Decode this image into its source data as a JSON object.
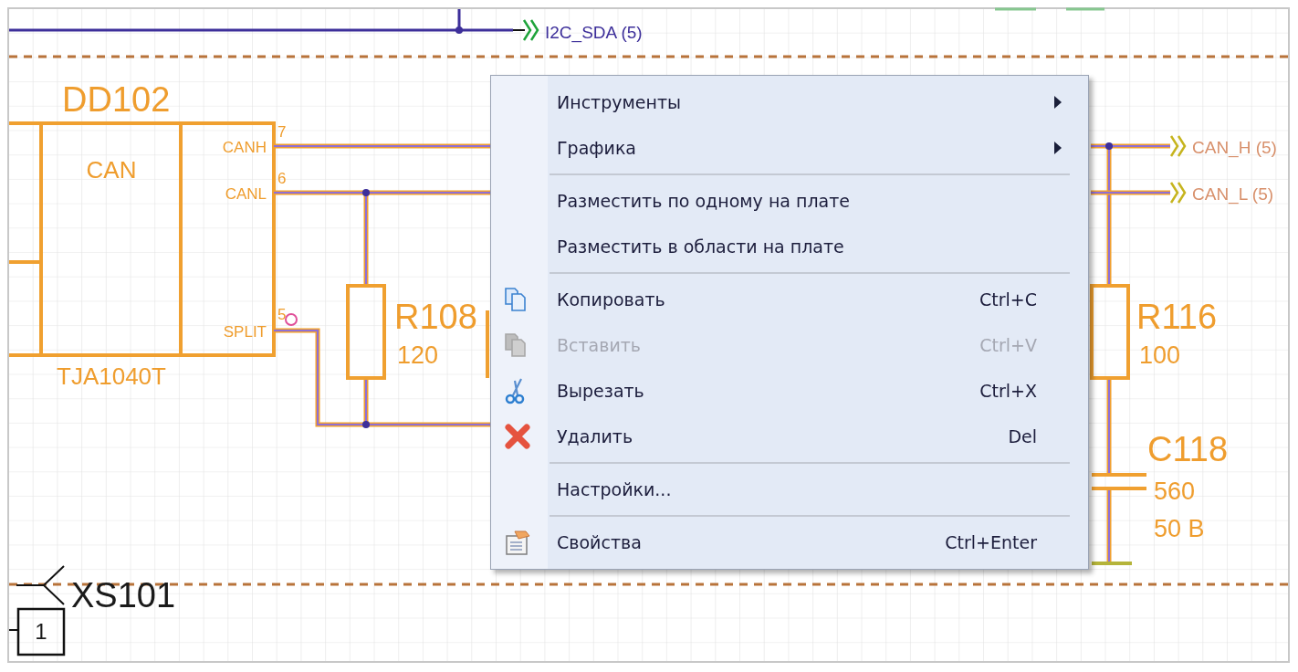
{
  "schematic": {
    "net_labels": [
      {
        "text": "I2C_SDA (5)"
      },
      {
        "text": "CAN_H (5)"
      },
      {
        "text": "CAN_L (5)"
      }
    ],
    "chip": {
      "ref": "DD102",
      "function": "CAN",
      "part": "TJA1040T",
      "pins": [
        {
          "name": "CANH",
          "number": "7"
        },
        {
          "name": "CANL",
          "number": "6"
        },
        {
          "name": "SPLIT",
          "number": "5"
        }
      ]
    },
    "resistors": [
      {
        "ref": "R108",
        "value": "120"
      },
      {
        "ref": "R116",
        "value": "100"
      }
    ],
    "capacitor": {
      "ref": "C118",
      "value": "560",
      "voltage": "50 В"
    },
    "connector": {
      "ref": "XS101",
      "pin": "1"
    }
  },
  "context_menu": {
    "items": [
      {
        "kind": "item",
        "label": "Инструменты",
        "submenu": true,
        "disabled": false
      },
      {
        "kind": "item",
        "label": "Графика",
        "submenu": true,
        "disabled": false
      },
      {
        "kind": "separator"
      },
      {
        "kind": "item",
        "label": "Разместить по одному на плате",
        "submenu": false,
        "disabled": false
      },
      {
        "kind": "item",
        "label": "Разместить в области на плате",
        "submenu": false,
        "disabled": false
      },
      {
        "kind": "separator"
      },
      {
        "kind": "item",
        "label": "Копировать",
        "shortcut": "Ctrl+C",
        "submenu": false,
        "disabled": false
      },
      {
        "kind": "item",
        "label": "Вставить",
        "shortcut": "Ctrl+V",
        "submenu": false,
        "disabled": true
      },
      {
        "kind": "item",
        "label": "Вырезать",
        "shortcut": "Ctrl+X",
        "submenu": false,
        "disabled": false
      },
      {
        "kind": "item",
        "label": "Удалить",
        "shortcut": "Del",
        "submenu": false,
        "disabled": false
      },
      {
        "kind": "separator"
      },
      {
        "kind": "item",
        "label": "Настройки...",
        "submenu": false,
        "disabled": false
      },
      {
        "kind": "separator"
      },
      {
        "kind": "item",
        "label": "Свойства",
        "shortcut": "Ctrl+Enter",
        "submenu": false,
        "disabled": false
      }
    ]
  }
}
